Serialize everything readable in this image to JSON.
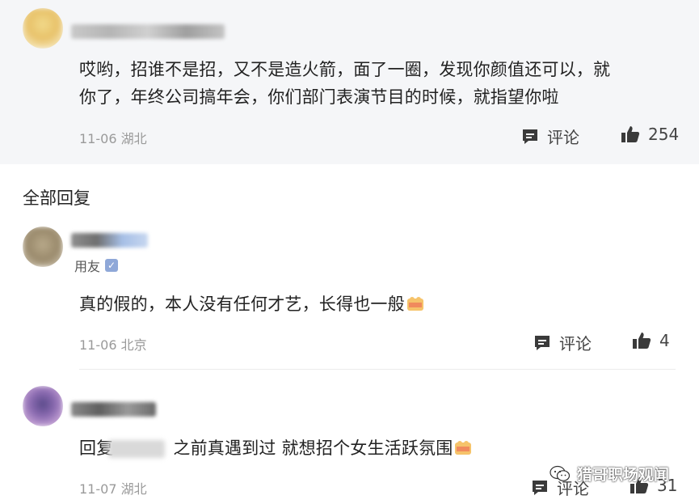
{
  "top_comment": {
    "text": "哎哟，招谁不是招，又不是造火箭，面了一圈，发现你颜值还可以，就你了，年终公司搞年会，你们部门表演节目的时候，就指望你啦",
    "line1": "哎哟，招谁不是招，又不是造火箭，面了一圈，发现你颜值还可以，就",
    "line2": "你了，年终公司搞年会，你们部门表演节目的时候，就指望你啦",
    "date_location": "11-06 湖北",
    "comment_label": "评论",
    "like_count": "254"
  },
  "replies_header": "全部回复",
  "replies": [
    {
      "user_tag": "用友",
      "verified_mark": "✓",
      "text": "真的假的，本人没有任何才艺，长得也一般",
      "date_location": "11-06 北京",
      "comment_label": "评论",
      "like_count": "4"
    },
    {
      "reply_prefix": "回复",
      "text": "之前真遇到过 就想招个女生活跃氛围",
      "date_location": "11-07 湖北",
      "comment_label": "评论",
      "like_count": "31"
    }
  ],
  "watermark": {
    "text": "猎哥职场观闻",
    "icon": "wechat-icon"
  },
  "colors": {
    "top_bg": "#f5f6f8",
    "meta_gray": "#9a9a9a",
    "icon_dark": "#3a3a3a",
    "verified_blue": "#8fa8d8"
  }
}
